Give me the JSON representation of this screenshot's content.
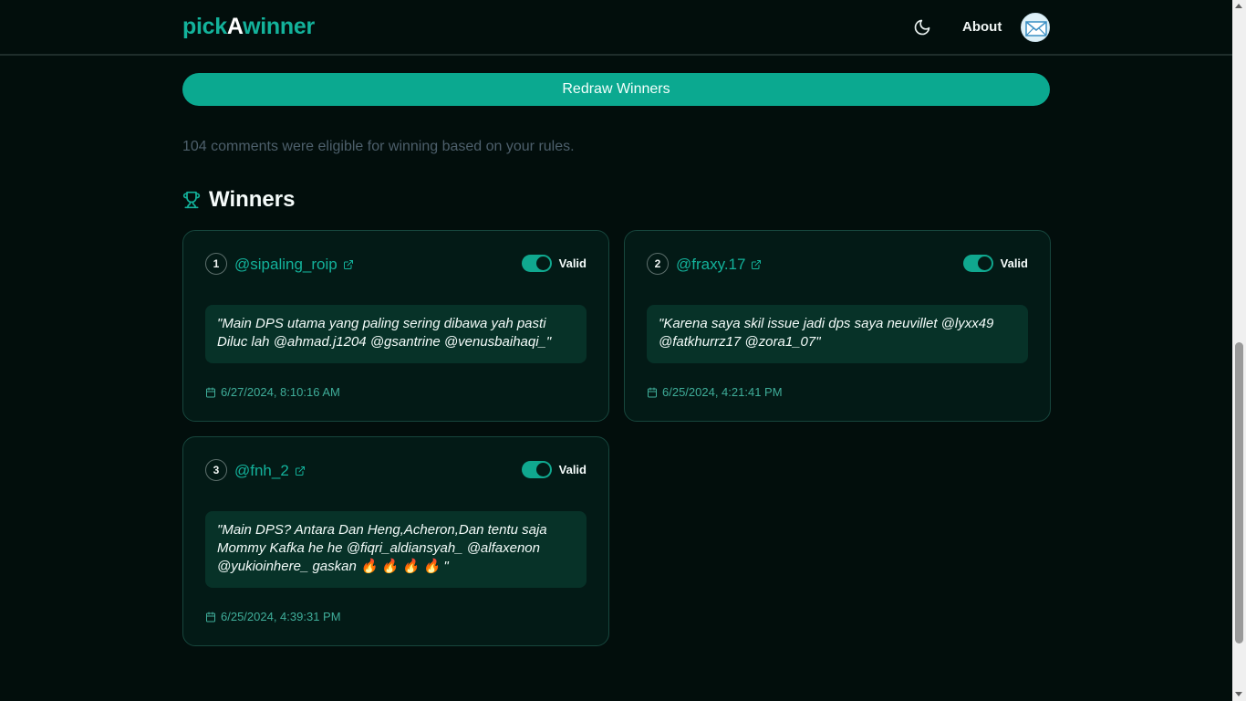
{
  "header": {
    "logo_pre": "pick",
    "logo_mid": "A",
    "logo_post": "winner",
    "about": "About",
    "theme_icon": "moon-icon",
    "avatar_icon": "mail-icon"
  },
  "redraw_label": "Redraw Winners",
  "eligible_text": "104 comments were eligible for winning based on your rules.",
  "winners_title": "Winners",
  "winners": [
    {
      "rank": "1",
      "username": "@sipaling_roip",
      "toggle_label": "Valid",
      "valid": true,
      "comment": "\"Main DPS utama yang paling sering dibawa yah pasti Diluc lah @ahmad.j1204 @gsantrine @venusbaihaqi_\"",
      "date": "6/27/2024, 8:10:16 AM"
    },
    {
      "rank": "2",
      "username": "@fraxy.17",
      "toggle_label": "Valid",
      "valid": true,
      "comment": "\"Karena saya skil issue jadi dps saya neuvillet @lyxx49 @fatkhurrz17 @zora1_07\"",
      "date": "6/25/2024, 4:21:41 PM"
    },
    {
      "rank": "3",
      "username": "@fnh_2",
      "toggle_label": "Valid",
      "valid": true,
      "comment": "\"Main DPS? Antara Dan Heng,Acheron,Dan tentu saja Mommy Kafka he he @fiqri_aldiansyah_ @alfaxenon @yukioinhere_ gaskan 🔥 🔥 🔥 🔥 \"",
      "date": "6/25/2024, 4:39:31 PM"
    }
  ],
  "colors": {
    "accent": "#13b29b",
    "background": "#020e0c",
    "card": "#031a16",
    "comment_bg": "#073228"
  }
}
